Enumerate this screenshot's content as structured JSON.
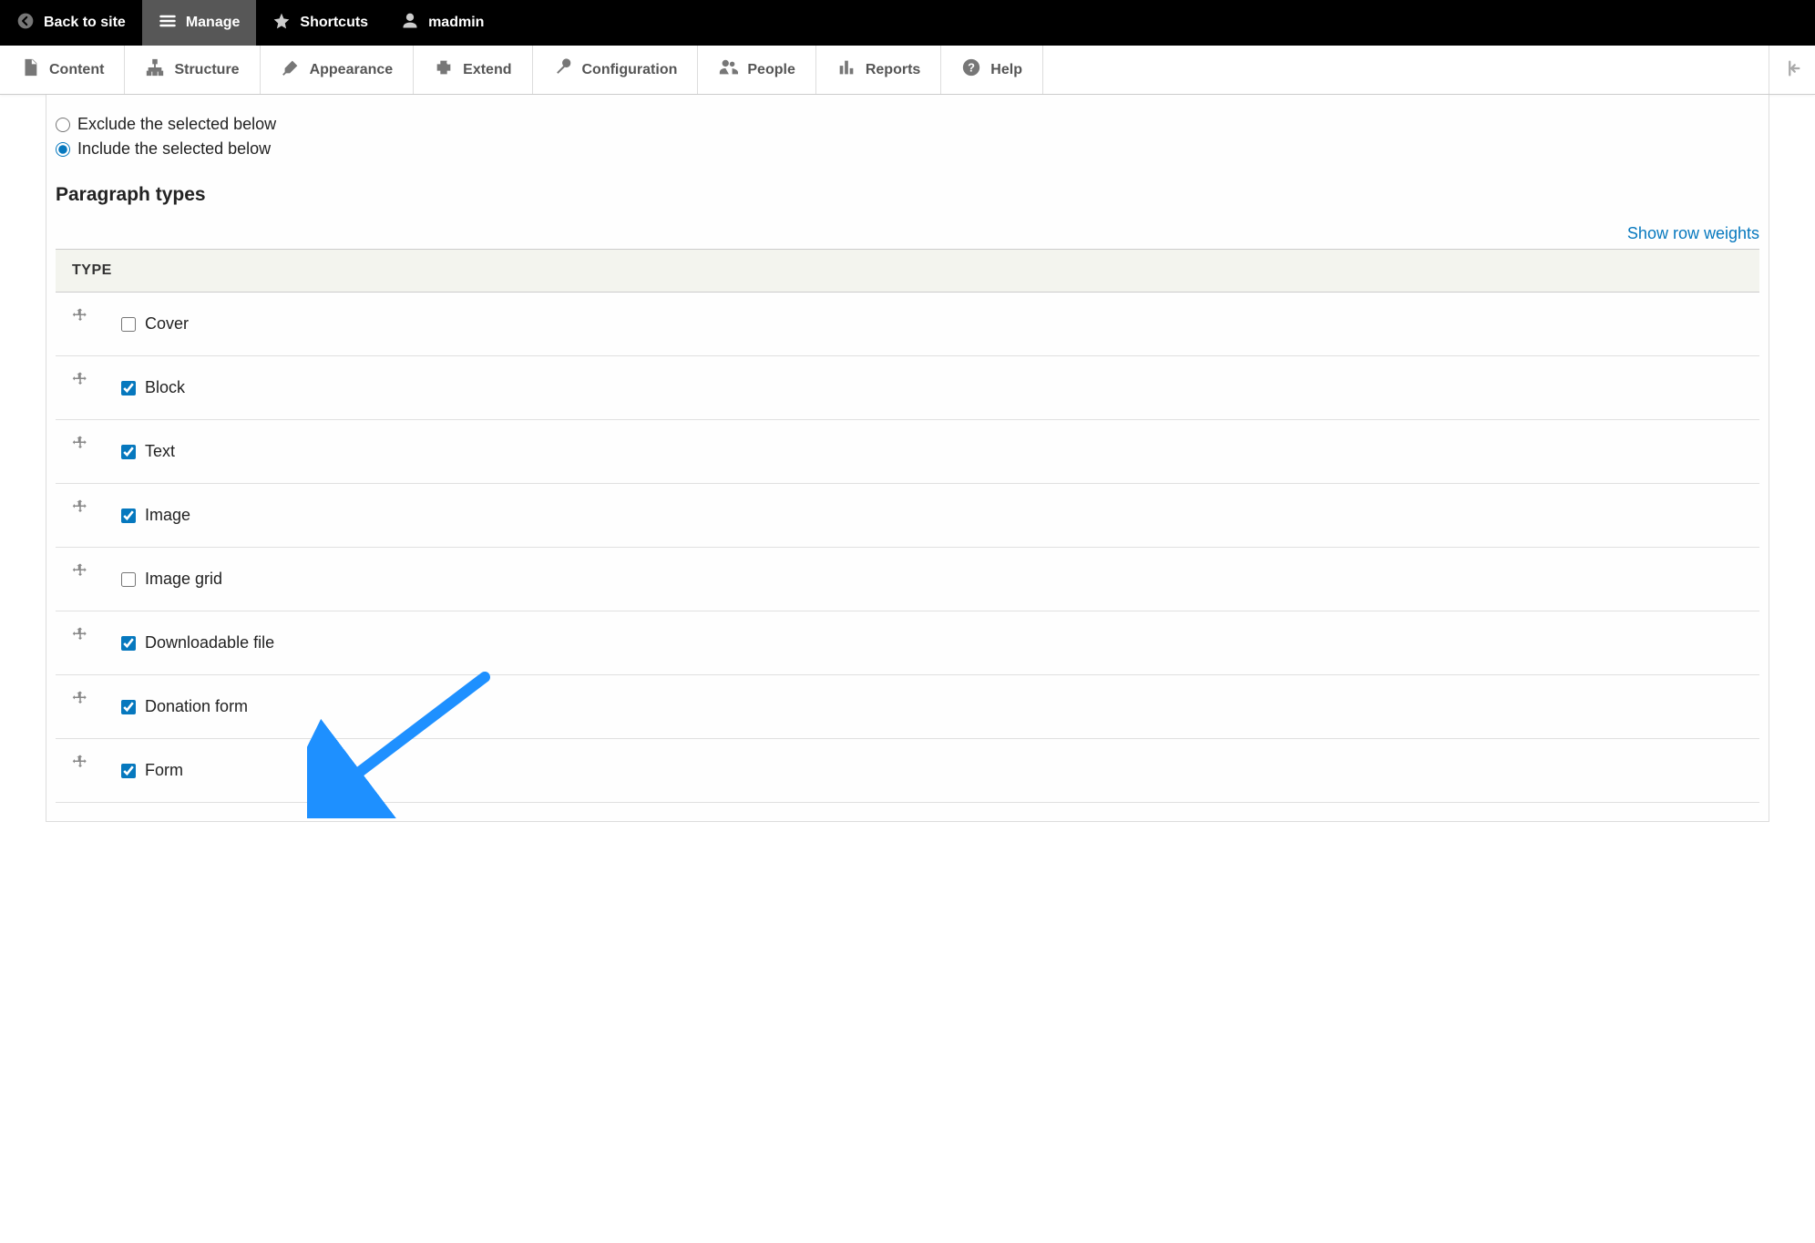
{
  "toolbar": {
    "back": "Back to site",
    "manage": "Manage",
    "shortcuts": "Shortcuts",
    "user": "madmin"
  },
  "adminbar": {
    "content": "Content",
    "structure": "Structure",
    "appearance": "Appearance",
    "extend": "Extend",
    "configuration": "Configuration",
    "people": "People",
    "reports": "Reports",
    "help": "Help"
  },
  "radios": {
    "exclude": "Exclude the selected below",
    "include": "Include the selected below",
    "selected": "include"
  },
  "section_heading": "Paragraph types",
  "show_row_weights": "Show row weights",
  "table": {
    "header": "TYPE",
    "rows": [
      {
        "label": "Cover",
        "checked": false
      },
      {
        "label": "Block",
        "checked": true
      },
      {
        "label": "Text",
        "checked": true
      },
      {
        "label": "Image",
        "checked": true
      },
      {
        "label": "Image grid",
        "checked": false
      },
      {
        "label": "Downloadable file",
        "checked": true
      },
      {
        "label": "Donation form",
        "checked": true
      },
      {
        "label": "Form",
        "checked": true
      }
    ]
  },
  "annotation": {
    "arrow_target_row_index": 6,
    "arrow_color": "#1e90ff"
  }
}
